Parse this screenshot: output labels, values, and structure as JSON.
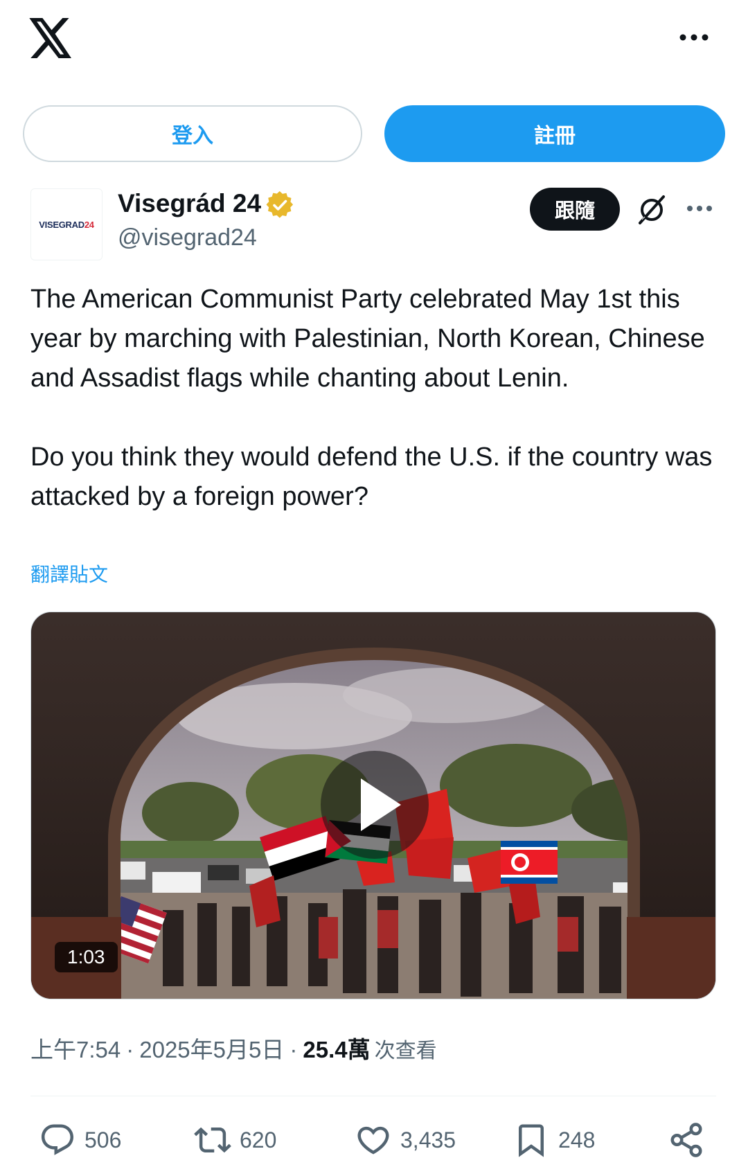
{
  "header": {
    "logo_icon": "x-logo-icon",
    "more_icon": "more-horizontal-icon"
  },
  "auth": {
    "login_label": "登入",
    "signup_label": "註冊"
  },
  "author": {
    "avatar_text_main": "VISEGRAD",
    "avatar_text_accent": "24",
    "display_name": "Visegrád 24",
    "verified_icon": "verified-badge-icon",
    "handle": "@visegrad24",
    "follow_label": "跟隨",
    "grok_icon": "grok-icon",
    "more_icon": "more-horizontal-icon"
  },
  "post": {
    "text": "The American Communist Party celebrated May 1st this year by marching with Palestinian, North Korean, Chinese and Assadist flags while chanting about Lenin.\n\nDo you think they would defend the U.S. if the country was attacked by a foreign power?",
    "translate_label": "翻譯貼文",
    "media": {
      "type": "video",
      "duration": "1:03",
      "play_icon": "play-icon"
    },
    "time": "上午7:54",
    "date": "2025年5月5日",
    "views_count": "25.4萬",
    "views_label": "次查看",
    "separator": "·"
  },
  "actions": {
    "replies": "506",
    "retweets": "620",
    "likes": "3,435",
    "bookmarks": "248"
  },
  "colors": {
    "accent": "#1d9bf0",
    "text": "#0f1419",
    "secondary": "#536471",
    "verified": "#e8b82c"
  }
}
